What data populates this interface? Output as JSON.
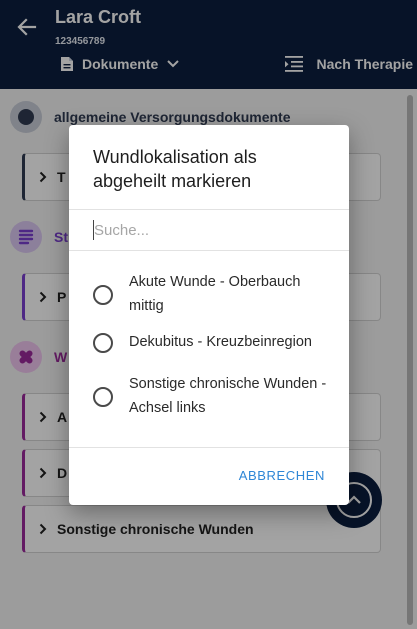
{
  "header": {
    "patient_name": "Lara Croft",
    "patient_id": "123456789",
    "doc_selector": "Dokumente",
    "sort_label": "Nach Therapie"
  },
  "sections": [
    {
      "label": "allgemeine Versorgungsdokumente",
      "color": "#2f3b52"
    },
    {
      "label": "St",
      "color": "#7b3fd0"
    },
    {
      "label": "W",
      "color": "#9c2a9c"
    }
  ],
  "cards": [
    {
      "label": "T",
      "accent": "#2f3b52"
    },
    {
      "label": "P",
      "accent": "#7b3fd0"
    },
    {
      "label": "A",
      "accent": "#9c2a9c"
    },
    {
      "label": "D",
      "accent": "#9c2a9c"
    },
    {
      "label": "Sonstige chronische Wunden",
      "accent": "#9c2a9c"
    }
  ],
  "dialog": {
    "title": "Wundlokalisation als abgeheilt markieren",
    "search_placeholder": "Suche...",
    "options": [
      {
        "label": "Akute Wunde - Oberbauch mittig"
      },
      {
        "label": "Dekubitus - Kreuzbeinregion"
      },
      {
        "label": "Sonstige chronische Wunden - Achsel links"
      }
    ],
    "cancel_label": "ABBRECHEN"
  },
  "colors": {
    "header_bg": "#0c1f3f",
    "accent_blue": "#2e86d6"
  }
}
